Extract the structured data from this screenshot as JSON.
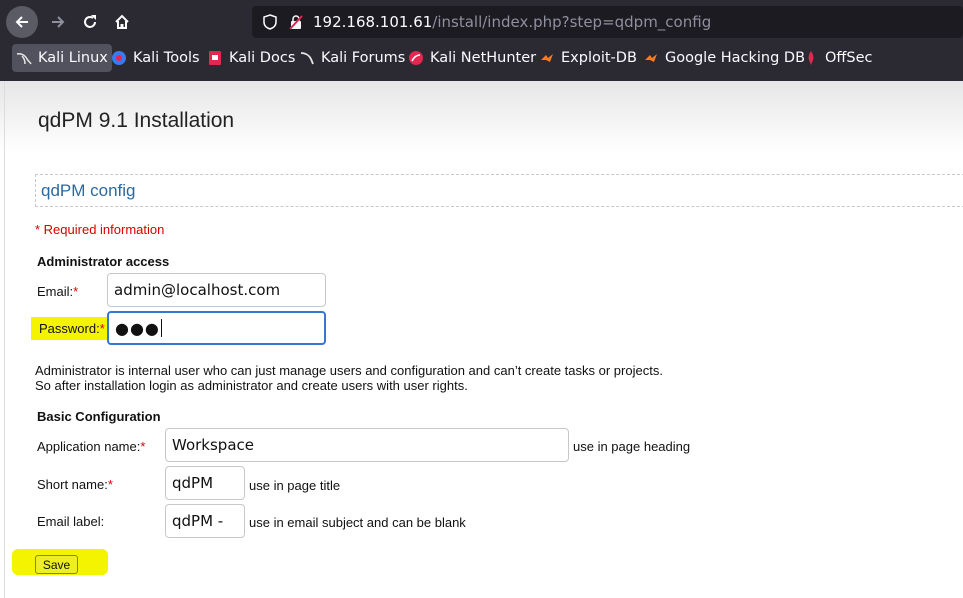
{
  "browser": {
    "url_host": "192.168.101.61",
    "url_path": "/install/index.php?step=qdpm_config",
    "bookmarks": [
      {
        "label": "Kali Linux",
        "icon": "kali-dragon-icon"
      },
      {
        "label": "Kali Tools",
        "icon": "kali-tools-icon"
      },
      {
        "label": "Kali Docs",
        "icon": "kali-docs-icon"
      },
      {
        "label": "Kali Forums",
        "icon": "kali-forums-icon"
      },
      {
        "label": "Kali NetHunter",
        "icon": "nethunter-icon"
      },
      {
        "label": "Exploit-DB",
        "icon": "exploit-db-icon"
      },
      {
        "label": "Google Hacking DB",
        "icon": "ghdb-icon"
      },
      {
        "label": "OffSec",
        "icon": "offsec-icon"
      }
    ]
  },
  "page": {
    "title": "qdPM 9.1 Installation",
    "section_title": "qdPM config",
    "required_info": "* Required information",
    "admin": {
      "heading": "Administrator access",
      "email_label": "Email:",
      "email_value": "admin@localhost.com",
      "password_label": "Password:",
      "password_value": "●●●",
      "note_line1": "Administrator is internal user who can just manage users and configuration and can’t create tasks or projects.",
      "note_line2": "So after installation login as administrator and create users with user rights."
    },
    "basic": {
      "heading": "Basic Configuration",
      "app_name_label": "Application name:",
      "app_name_value": "Workspace",
      "app_name_hint": "use in page heading",
      "short_name_label": "Short name:",
      "short_name_value": "qdPM",
      "short_name_hint": "use in page title",
      "email_label_label": "Email label:",
      "email_label_value": "qdPM -",
      "email_label_hint": "use in email subject and can be blank"
    },
    "required_star": "*",
    "save_label": "Save"
  },
  "colors": {
    "required": "#d60000",
    "highlight": "#f4f400",
    "section_title": "#2a6aa0",
    "focus_border": "#3478d4"
  }
}
